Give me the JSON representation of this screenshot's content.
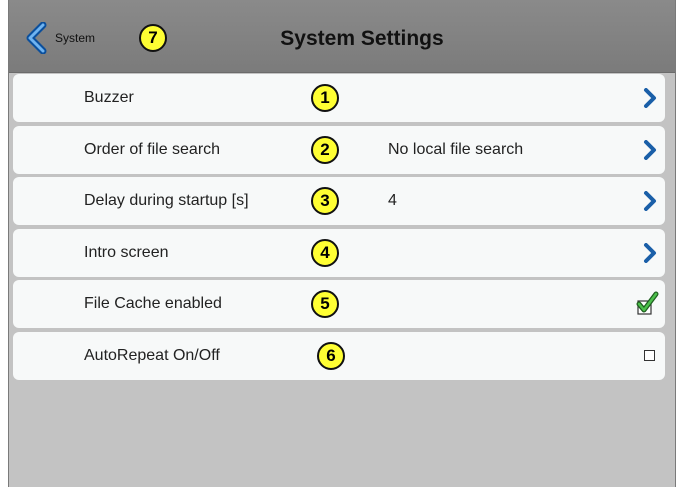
{
  "header": {
    "back_label": "System",
    "back_badge": "7",
    "title": "System Settings"
  },
  "rows": [
    {
      "label": "Buzzer",
      "badge": "1",
      "value": "",
      "control": "chevron-right-icon"
    },
    {
      "label": "Order of file search",
      "badge": "2",
      "value": "No local file search",
      "control": "chevron-right-icon"
    },
    {
      "label": "Delay during startup [s]",
      "badge": "3",
      "value": "4",
      "control": "chevron-right-icon"
    },
    {
      "label": "Intro screen",
      "badge": "4",
      "value": "",
      "control": "chevron-right-icon"
    },
    {
      "label": "File Cache enabled",
      "badge": "5",
      "value": "",
      "control": "checkbox",
      "checked": true
    },
    {
      "label": "AutoRepeat On/Off",
      "badge": "6",
      "value": "",
      "control": "checkbox",
      "checked": false
    }
  ],
  "colors": {
    "badge_fill": "#ffff33",
    "chevron": "#1a5fa8",
    "check": "#2e8b2e",
    "row_bg": "#f7f9f9",
    "panel_bg": "#c3c3c3",
    "header_bg": "#7f7f7f"
  }
}
